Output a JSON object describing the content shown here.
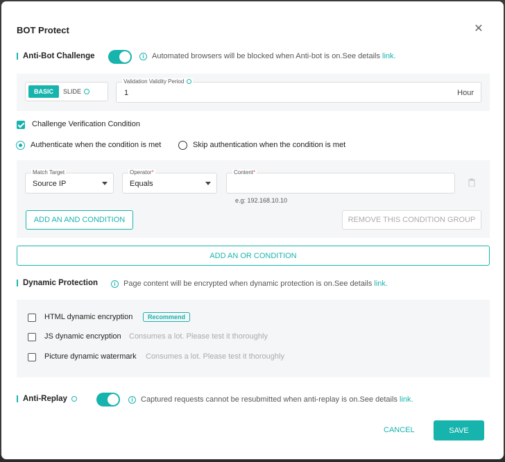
{
  "modal": {
    "title": "BOT Protect"
  },
  "anti_bot": {
    "title": "Anti-Bot Challenge",
    "enabled": true,
    "info_text": "Automated browsers will be blocked when Anti-bot is on.See details",
    "link_label": "link.",
    "mode_basic": "BASIC",
    "mode_slide": "SLIDE",
    "validity_label": "Validation Validity Period",
    "validity_value": "1",
    "validity_unit": "Hour",
    "challenge_condition_label": "Challenge Verification Condition",
    "radio_auth": "Authenticate when the condition is met",
    "radio_skip": "Skip authentication when the condition is met",
    "match_target_label": "Match Target",
    "match_target_value": "Source IP",
    "operator_label": "Operator",
    "operator_value": "Equals",
    "content_label": "Content",
    "content_value": "",
    "content_hint": "e.g: 192.168.10.10",
    "add_and_label": "ADD AN AND CONDITION",
    "remove_group_label": "REMOVE THIS CONDITION GROUP",
    "add_or_label": "ADD AN OR CONDITION"
  },
  "dynamic": {
    "title": "Dynamic Protection",
    "info_text": "Page content will be encrypted when dynamic protection is on.See details",
    "link_label": "link.",
    "items": [
      {
        "label": "HTML dynamic encryption",
        "badge": "Recommend",
        "note": ""
      },
      {
        "label": "JS dynamic encryption",
        "badge": "",
        "note": "Consumes a lot. Please test it thoroughly"
      },
      {
        "label": "Picture dynamic watermark",
        "badge": "",
        "note": "Consumes a lot. Please test it thoroughly"
      }
    ]
  },
  "anti_replay": {
    "title": "Anti-Replay",
    "enabled": true,
    "info_text": "Captured requests cannot be resubmitted when anti-replay is on.See details",
    "link_label": "link."
  },
  "footer": {
    "cancel_label": "CANCEL",
    "save_label": "SAVE"
  },
  "colors": {
    "accent": "#17b3ad"
  },
  "icons": {
    "close": "close-icon",
    "info": "info-icon",
    "help": "help-icon",
    "trash": "trash-icon",
    "caret": "chevron-down-icon"
  }
}
